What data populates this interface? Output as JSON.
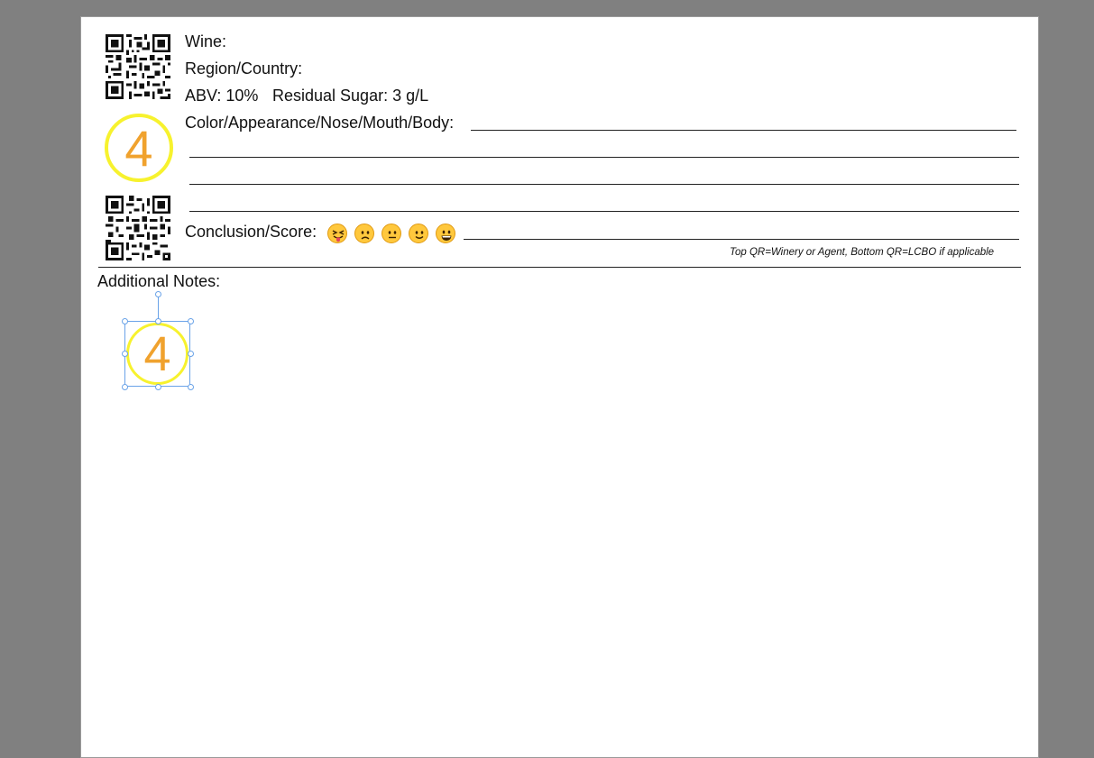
{
  "card": {
    "wine_label": "Wine:",
    "region_label": "Region/Country:",
    "abv_label": "ABV: 10%",
    "sugar_label": "Residual Sugar: 3 g/L",
    "notes_label": "Color/Appearance/Nose/Mouth/Body:",
    "score_label": "Conclusion/Score:",
    "qr_footnote": "Top QR=Winery or Agent, Bottom QR=LCBO if applicable",
    "badge_number": "4"
  },
  "additional": {
    "label": "Additional Notes:",
    "selected_badge_number": "4"
  },
  "score_emojis": [
    "tongue-out-face-icon",
    "frowning-face-icon",
    "neutral-face-icon",
    "slightly-smiling-face-icon",
    "grinning-face-icon"
  ],
  "colors": {
    "badge_ring": "#f7f22e",
    "badge_digit": "#f0a22e",
    "selection": "#6aa3e8",
    "canvas": "#808080"
  }
}
